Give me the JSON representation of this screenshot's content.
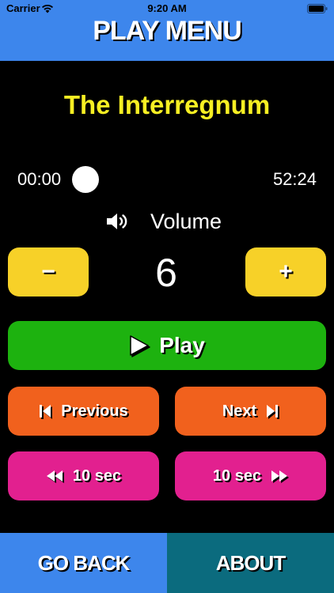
{
  "status_bar": {
    "carrier": "Carrier",
    "time": "9:20 AM"
  },
  "header": {
    "title": "PLAY MENU"
  },
  "track": {
    "title": "The Interregnum"
  },
  "progress": {
    "elapsed": "00:00",
    "total": "52:24",
    "fraction": 0
  },
  "volume": {
    "label": "Volume",
    "value": "6",
    "minus_label": "−",
    "plus_label": "+"
  },
  "controls": {
    "play_label": "Play",
    "previous_label": "Previous",
    "next_label": "Next",
    "rewind_label": "10 sec",
    "forward_label": "10 sec"
  },
  "footer": {
    "back_label": "GO BACK",
    "about_label": "ABOUT"
  },
  "colors": {
    "header": "#3d86ec",
    "track_title": "#f7ef23",
    "volume_buttons": "#f7d128",
    "play": "#1db20f",
    "prev_next": "#f1611d",
    "seek": "#e2208f",
    "footer_back": "#3d86ec",
    "footer_about": "#0b6b7e"
  },
  "icons": {
    "wifi": "wifi-icon",
    "battery": "battery-icon",
    "speaker": "speaker-icon",
    "play": "play-triangle-icon",
    "previous": "skip-previous-icon",
    "next": "skip-next-icon",
    "rewind": "rewind-icon",
    "forward": "fast-forward-icon"
  }
}
